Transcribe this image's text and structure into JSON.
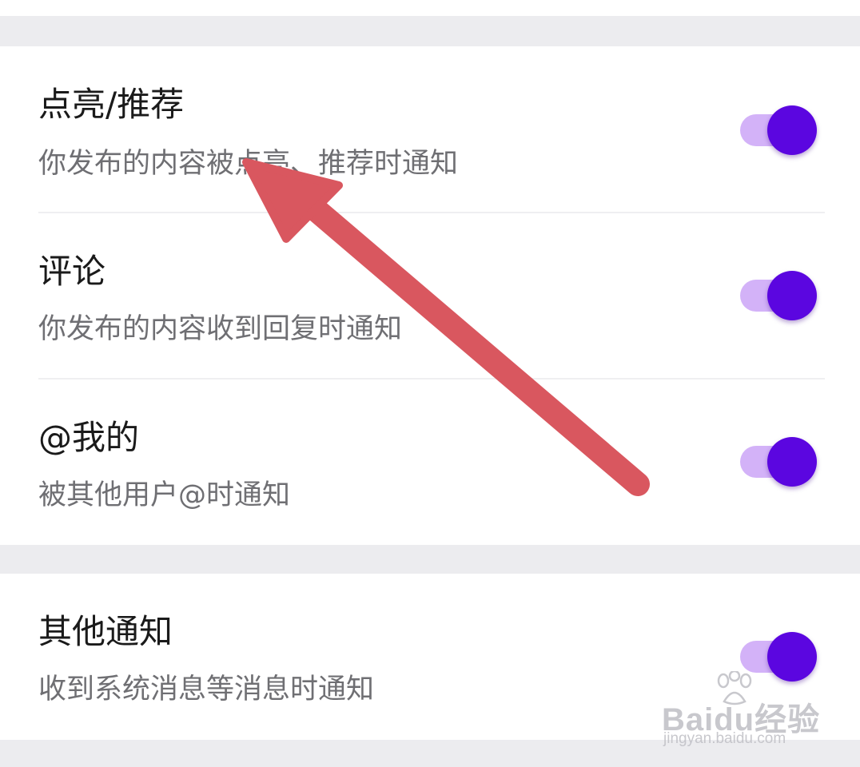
{
  "settings": [
    {
      "title": "点亮/推荐",
      "desc": "你发布的内容被点亮、推荐时通知",
      "enabled": true
    },
    {
      "title": "评论",
      "desc": "你发布的内容收到回复时通知",
      "enabled": true
    },
    {
      "title": "@我的",
      "desc": "被其他用户@时通知",
      "enabled": true
    },
    {
      "title": "其他通知",
      "desc": "收到系统消息等消息时通知",
      "enabled": true
    }
  ],
  "colors": {
    "accent": "#5b06e0",
    "track": "#d3b2f8",
    "annotation_arrow": "#d9575f",
    "section_gap": "#ececef"
  },
  "watermark": {
    "logo": "Baidu经验",
    "url": "jingyan.baidu.com",
    "icon": "baidu-paw-icon"
  },
  "annotation": {
    "icon": "arrow-annotation"
  }
}
